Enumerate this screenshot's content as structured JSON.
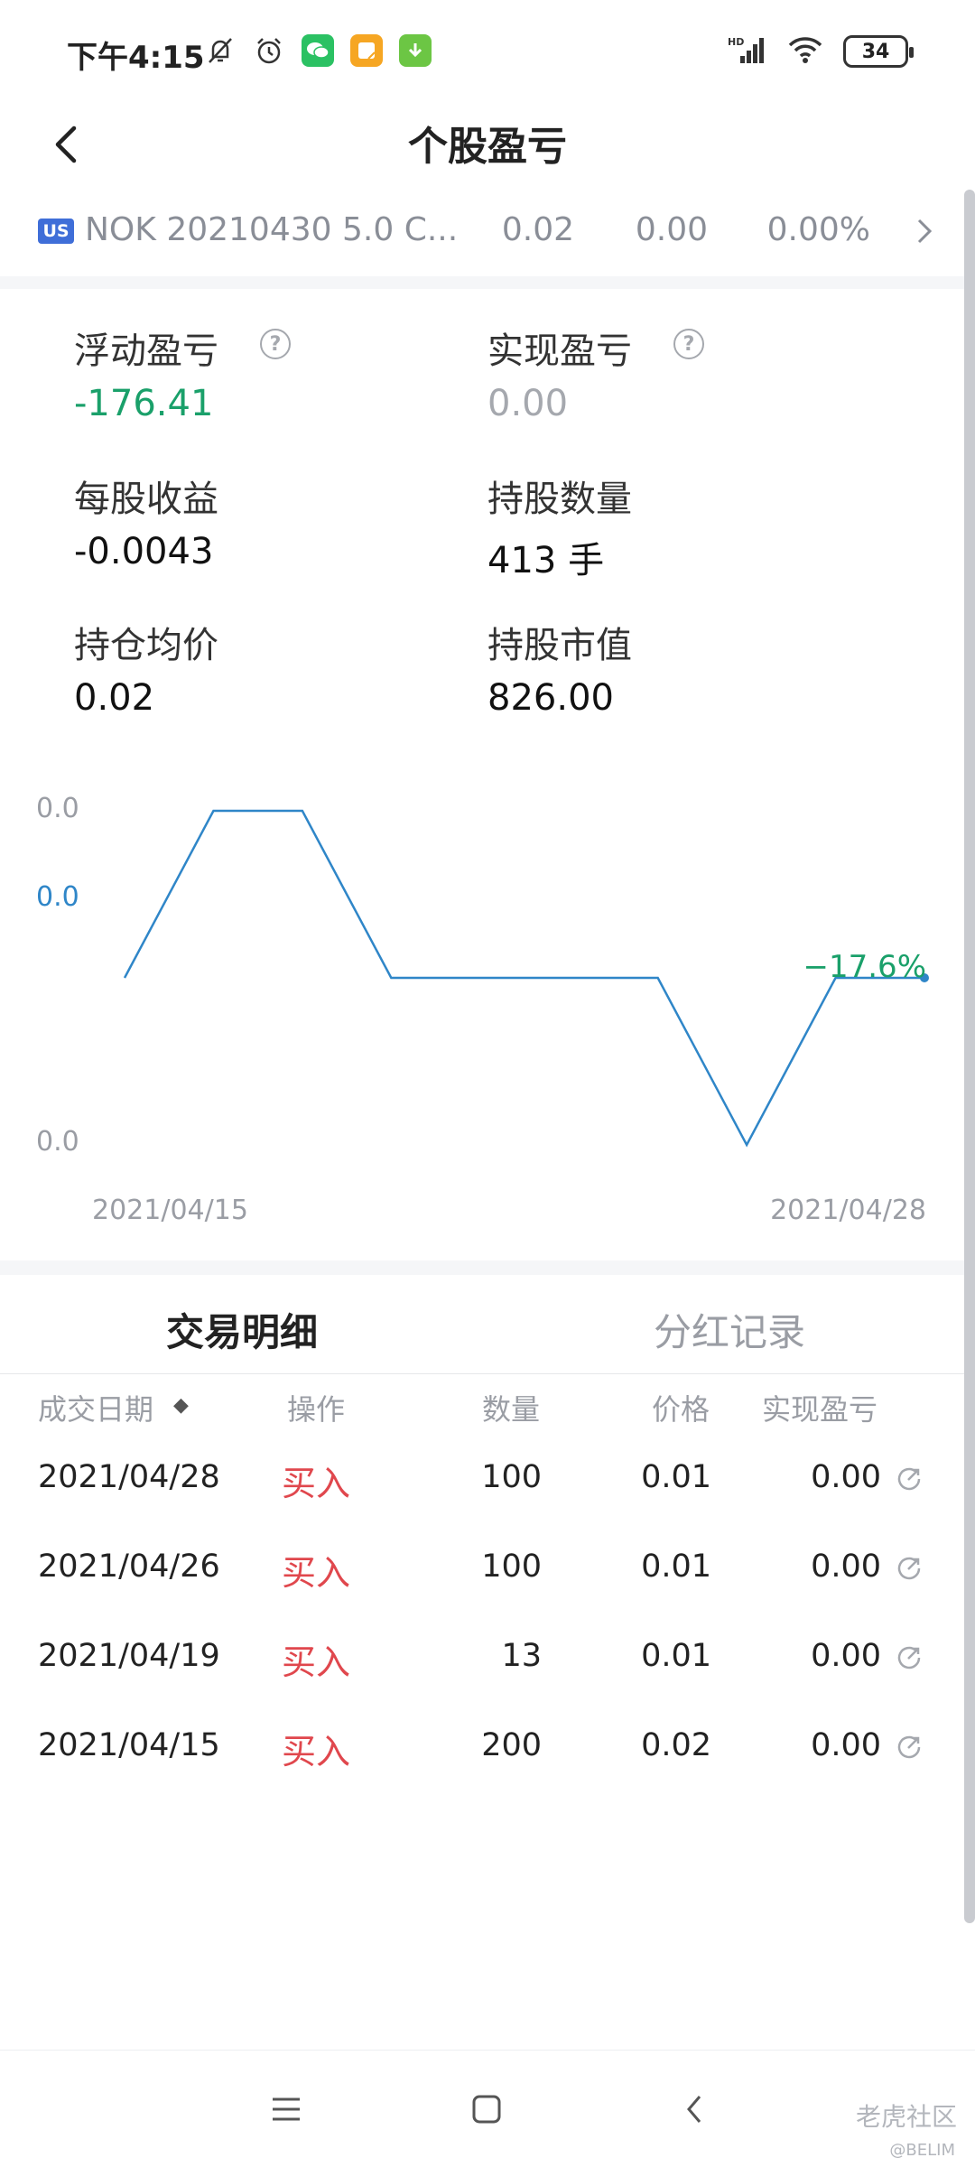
{
  "status_bar": {
    "time": "下午4:15",
    "battery": "34",
    "network": "HD"
  },
  "header": {
    "title": "个股盈亏"
  },
  "ticker": {
    "market": "US",
    "name": "NOK 20210430 5.0 C...",
    "price": "0.02",
    "change": "0.00",
    "change_pct": "0.00%"
  },
  "stats": {
    "floating_pl_label": "浮动盈亏",
    "floating_pl_value": "-176.41",
    "realized_pl_label": "实现盈亏",
    "realized_pl_value": "0.00",
    "eps_label": "每股收益",
    "eps_value": "-0.0043",
    "shares_label": "持股数量",
    "shares_value": "413 手",
    "avg_cost_label": "持仓均价",
    "avg_cost_value": "0.02",
    "market_value_label": "持股市值",
    "market_value_value": "826.00",
    "help_glyph": "?"
  },
  "chart_data": {
    "type": "line",
    "y_tick_labels": [
      "0.0",
      "0.0",
      "0.0"
    ],
    "x_tick_labels": [
      "2021/04/15",
      "2021/04/28"
    ],
    "end_label": "−17.6%",
    "series": [
      {
        "values": [
          0,
          1,
          1,
          0,
          0,
          0,
          0,
          -1,
          0,
          0
        ]
      }
    ],
    "colors": {
      "line": "#2f86c8",
      "end_label": "#1aa06a",
      "axis_text": "#9a9da4",
      "mid_label": "#2f86c8"
    }
  },
  "tabs": [
    {
      "label": "交易明细",
      "active": true
    },
    {
      "label": "分红记录",
      "active": false
    }
  ],
  "table": {
    "headers": {
      "date": "成交日期",
      "sort": "◆",
      "op": "操作",
      "qty": "数量",
      "price": "价格",
      "pl": "实现盈亏"
    },
    "rows": [
      {
        "date": "2021/04/28",
        "op": "买入",
        "qty": "100",
        "price": "0.01",
        "pl": "0.00"
      },
      {
        "date": "2021/04/26",
        "op": "买入",
        "qty": "100",
        "price": "0.01",
        "pl": "0.00"
      },
      {
        "date": "2021/04/19",
        "op": "买入",
        "qty": "13",
        "price": "0.01",
        "pl": "0.00"
      },
      {
        "date": "2021/04/15",
        "op": "买入",
        "qty": "200",
        "price": "0.02",
        "pl": "0.00"
      }
    ]
  },
  "watermark": {
    "brand": "老虎社区",
    "user": "@BELIM"
  },
  "colors": {
    "green": "#1aa06a",
    "red": "#e0474d",
    "grey": "#9a9da4",
    "accent": "#3f6ed8"
  }
}
